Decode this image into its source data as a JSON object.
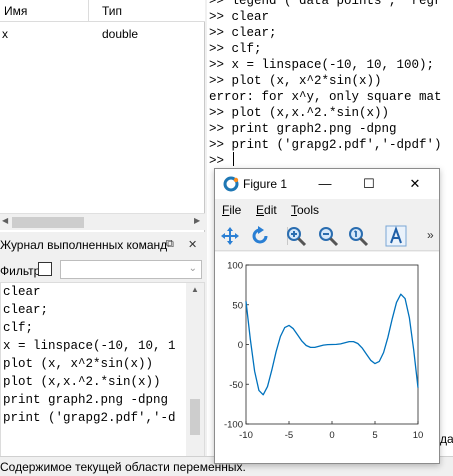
{
  "variables": {
    "headers": {
      "name": "Имя",
      "type": "Тип"
    },
    "rows": [
      {
        "name": "x",
        "type": "double"
      }
    ]
  },
  "history": {
    "title": "Журнал выполненных команд",
    "filter_label": "Фильтр",
    "filter_value": "",
    "items": [
      "clear",
      "clear;",
      "clf;",
      "x = linspace(-10, 10, 1",
      "plot (x, x^2*sin(x))",
      "plot (x,x.^2.*sin(x))",
      "print graph2.png -dpng",
      "print ('grapg2.pdf','-d"
    ]
  },
  "command_window": {
    "lines": [
      ">> legend ('data points', 'regr",
      ">> clear",
      ">> clear;",
      ">> clf;",
      ">> x = linspace(-10, 10, 100);",
      ">> plot (x, x^2*sin(x))",
      "error: for x^y, only square mat",
      ">> plot (x,x.^2.*sin(x))",
      ">> print graph2.png -dpng",
      ">> print ('grapg2.pdf','-dpdf')",
      ">>"
    ],
    "partial_text": "дан"
  },
  "status_bar": {
    "text": "Содержимое текущей области переменных."
  },
  "figure": {
    "title": "Figure 1",
    "menus": [
      {
        "label": "File"
      },
      {
        "label": "Edit"
      },
      {
        "label": "Tools"
      }
    ],
    "toolbar_more": "»",
    "window_buttons": {
      "minimize": "—",
      "maximize": "☐",
      "close": "✕"
    }
  },
  "chart_data": {
    "type": "line",
    "title": "",
    "xlabel": "",
    "ylabel": "",
    "xlim": [
      -10,
      10
    ],
    "ylim": [
      -100,
      100
    ],
    "xticks": [
      -10,
      -5,
      0,
      5,
      10
    ],
    "yticks": [
      -100,
      -50,
      0,
      50,
      100
    ],
    "series": [
      {
        "color": "#0072bd",
        "x": [
          -10,
          -9.5,
          -9,
          -8.5,
          -8,
          -7.5,
          -7,
          -6.5,
          -6,
          -5.5,
          -5,
          -4.5,
          -4,
          -3.5,
          -3,
          -2.5,
          -2,
          -1.5,
          -1,
          -0.5,
          0,
          0.5,
          1,
          1.5,
          2,
          2.5,
          3,
          3.5,
          4,
          4.5,
          5,
          5.5,
          6,
          6.5,
          7,
          7.5,
          8,
          8.5,
          9,
          9.5,
          10
        ],
        "y": [
          54.4,
          6.8,
          -33.4,
          -57.7,
          -63.3,
          -52.9,
          -32.2,
          -9.1,
          10.1,
          21.3,
          24.0,
          19.9,
          12.1,
          4.3,
          -1.3,
          -3.7,
          -3.6,
          -2.2,
          -0.8,
          -0.1,
          0,
          0.1,
          0.8,
          2.2,
          3.6,
          3.7,
          1.3,
          -4.3,
          -12.1,
          -19.9,
          -24.0,
          -21.3,
          -10.1,
          9.1,
          32.2,
          52.9,
          63.3,
          57.7,
          33.4,
          -6.8,
          -54.4
        ]
      }
    ]
  }
}
